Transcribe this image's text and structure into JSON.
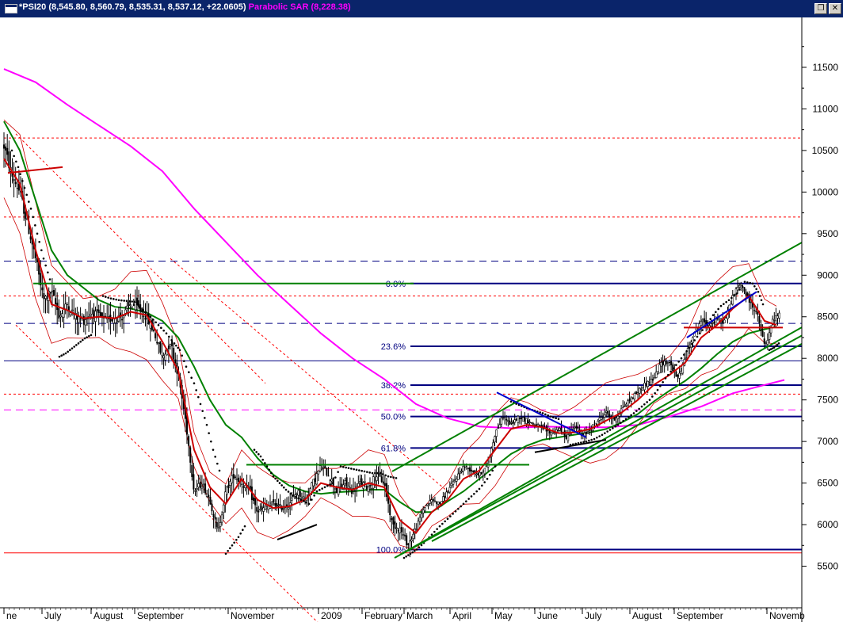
{
  "window": {
    "title_symbol": "*PSI20",
    "title_values": "(8,545.80, 8,560.79, 8,535.31, 8,537.12, +22.0605)",
    "title_indicator": "Parabolic SAR",
    "title_indicator_value": "(8,228.38)",
    "restore_glyph": "❐",
    "close_glyph": "✕",
    "icons": [
      "window-menu-icon",
      "restore-icon",
      "close-icon"
    ]
  },
  "chart_data": {
    "type": "line",
    "title": "*PSI20 (8,545.80, 8,560.79, 8,535.31, 8,537.12, +22.0605) Parabolic SAR (8,228.38)",
    "yticks": [
      5500,
      6000,
      6500,
      7000,
      7500,
      8000,
      8500,
      9000,
      9500,
      10000,
      10500,
      11000,
      11500
    ],
    "ylim": [
      5000,
      12100
    ],
    "xlabels": [
      "ne",
      "July",
      "August",
      "September",
      "November",
      "2009",
      "February",
      "March",
      "April",
      "May",
      "June",
      "July",
      "August",
      "September",
      "Novemb"
    ],
    "x_axis_note": "daily bars, June 2008 to November 2009",
    "colors": {
      "price": "#000000",
      "ma_fast": "#cc0000",
      "ma_mid": "#008000",
      "ma_slow": "#ff00ff",
      "envelope": "#cc0000",
      "sar": "#000000",
      "fib": "#000080",
      "trend_green": "#008000",
      "grid_red": "#ff0000",
      "grid_blue": "#000080"
    },
    "fibonacci": {
      "high": 8900,
      "low": 5700,
      "levels": [
        {
          "label": "0.0%",
          "value": 8900
        },
        {
          "label": "23.6%",
          "value": 8145
        },
        {
          "label": "38.2%",
          "value": 7678
        },
        {
          "label": "50.0%",
          "value": 7300
        },
        {
          "label": "61.8%",
          "value": 6922
        },
        {
          "label": "100.0%",
          "value": 5700
        }
      ]
    },
    "horizontal_lines": [
      {
        "value": 10650,
        "style": "red-dotted"
      },
      {
        "value": 9700,
        "style": "red-dotted"
      },
      {
        "value": 9170,
        "style": "blue-dashed"
      },
      {
        "value": 8750,
        "style": "red-dotted"
      },
      {
        "value": 8420,
        "style": "blue-dashed"
      },
      {
        "value": 7970,
        "style": "blue-solid"
      },
      {
        "value": 7570,
        "style": "red-dotted"
      },
      {
        "value": 7380,
        "style": "magenta-dashed"
      },
      {
        "value": 5660,
        "style": "red-solid"
      }
    ],
    "price_path": [
      [
        0,
        10550
      ],
      [
        10,
        10200
      ],
      [
        20,
        10000
      ],
      [
        30,
        9600
      ],
      [
        40,
        9200
      ],
      [
        50,
        8700
      ],
      [
        60,
        8800
      ],
      [
        70,
        8500
      ],
      [
        80,
        8650
      ],
      [
        90,
        8500
      ],
      [
        100,
        8450
      ],
      [
        110,
        8550
      ],
      [
        120,
        8500
      ],
      [
        130,
        8450
      ],
      [
        140,
        8500
      ],
      [
        150,
        8500
      ],
      [
        160,
        8650
      ],
      [
        170,
        8600
      ],
      [
        180,
        8500
      ],
      [
        190,
        8300
      ],
      [
        200,
        8000
      ],
      [
        210,
        8200
      ],
      [
        220,
        7800
      ],
      [
        230,
        7200
      ],
      [
        240,
        6400
      ],
      [
        250,
        6500
      ],
      [
        260,
        6300
      ],
      [
        270,
        5900
      ],
      [
        280,
        6400
      ],
      [
        290,
        6600
      ],
      [
        300,
        6500
      ],
      [
        310,
        6400
      ],
      [
        320,
        6150
      ],
      [
        330,
        6200
      ],
      [
        340,
        6250
      ],
      [
        350,
        6200
      ],
      [
        360,
        6250
      ],
      [
        370,
        6400
      ],
      [
        380,
        6300
      ],
      [
        390,
        6500
      ],
      [
        400,
        6700
      ],
      [
        410,
        6600
      ],
      [
        420,
        6400
      ],
      [
        430,
        6500
      ],
      [
        440,
        6400
      ],
      [
        450,
        6500
      ],
      [
        460,
        6450
      ],
      [
        470,
        6600
      ],
      [
        480,
        6500
      ],
      [
        490,
        6000
      ],
      [
        500,
        5950
      ],
      [
        510,
        5750
      ],
      [
        520,
        5950
      ],
      [
        530,
        6200
      ],
      [
        540,
        6300
      ],
      [
        550,
        6250
      ],
      [
        560,
        6400
      ],
      [
        570,
        6550
      ],
      [
        580,
        6700
      ],
      [
        590,
        6650
      ],
      [
        600,
        6600
      ],
      [
        610,
        6700
      ],
      [
        620,
        7100
      ],
      [
        630,
        7300
      ],
      [
        640,
        7200
      ],
      [
        650,
        7300
      ],
      [
        660,
        7250
      ],
      [
        670,
        7200
      ],
      [
        680,
        7150
      ],
      [
        690,
        7100
      ],
      [
        700,
        7150
      ],
      [
        710,
        7050
      ],
      [
        720,
        7200
      ],
      [
        730,
        7050
      ],
      [
        740,
        7150
      ],
      [
        750,
        7250
      ],
      [
        760,
        7350
      ],
      [
        770,
        7250
      ],
      [
        780,
        7400
      ],
      [
        790,
        7500
      ],
      [
        800,
        7600
      ],
      [
        810,
        7700
      ],
      [
        820,
        7750
      ],
      [
        830,
        7950
      ],
      [
        840,
        7950
      ],
      [
        850,
        7750
      ],
      [
        860,
        8000
      ],
      [
        870,
        8300
      ],
      [
        880,
        8450
      ],
      [
        890,
        8400
      ],
      [
        900,
        8450
      ],
      [
        910,
        8450
      ],
      [
        920,
        8750
      ],
      [
        930,
        8900
      ],
      [
        940,
        8700
      ],
      [
        950,
        8550
      ],
      [
        960,
        8150
      ],
      [
        965,
        8250
      ],
      [
        970,
        8450
      ],
      [
        980,
        8540
      ]
    ],
    "ma_fast": [
      [
        0,
        10400
      ],
      [
        20,
        10100
      ],
      [
        40,
        9300
      ],
      [
        60,
        8650
      ],
      [
        80,
        8580
      ],
      [
        100,
        8480
      ],
      [
        120,
        8500
      ],
      [
        140,
        8480
      ],
      [
        160,
        8560
      ],
      [
        180,
        8520
      ],
      [
        200,
        8200
      ],
      [
        220,
        7850
      ],
      [
        240,
        6900
      ],
      [
        260,
        6450
      ],
      [
        280,
        6250
      ],
      [
        300,
        6550
      ],
      [
        320,
        6300
      ],
      [
        340,
        6200
      ],
      [
        360,
        6220
      ],
      [
        380,
        6300
      ],
      [
        400,
        6500
      ],
      [
        420,
        6450
      ],
      [
        440,
        6420
      ],
      [
        460,
        6500
      ],
      [
        480,
        6450
      ],
      [
        500,
        6050
      ],
      [
        520,
        5900
      ],
      [
        540,
        6150
      ],
      [
        560,
        6300
      ],
      [
        580,
        6550
      ],
      [
        600,
        6650
      ],
      [
        620,
        6900
      ],
      [
        640,
        7150
      ],
      [
        660,
        7200
      ],
      [
        680,
        7170
      ],
      [
        700,
        7100
      ],
      [
        720,
        7110
      ],
      [
        740,
        7150
      ],
      [
        760,
        7250
      ],
      [
        780,
        7350
      ],
      [
        800,
        7500
      ],
      [
        820,
        7680
      ],
      [
        840,
        7800
      ],
      [
        860,
        7950
      ],
      [
        880,
        8250
      ],
      [
        900,
        8400
      ],
      [
        920,
        8600
      ],
      [
        940,
        8750
      ],
      [
        960,
        8450
      ],
      [
        975,
        8400
      ]
    ],
    "ma_mid": [
      [
        0,
        10850
      ],
      [
        20,
        10500
      ],
      [
        40,
        9900
      ],
      [
        60,
        9300
      ],
      [
        80,
        9000
      ],
      [
        100,
        8850
      ],
      [
        120,
        8700
      ],
      [
        140,
        8620
      ],
      [
        160,
        8600
      ],
      [
        180,
        8550
      ],
      [
        200,
        8450
      ],
      [
        220,
        8250
      ],
      [
        240,
        7900
      ],
      [
        260,
        7500
      ],
      [
        280,
        7200
      ],
      [
        300,
        7050
      ],
      [
        320,
        6800
      ],
      [
        340,
        6600
      ],
      [
        360,
        6470
      ],
      [
        380,
        6400
      ],
      [
        400,
        6370
      ],
      [
        420,
        6390
      ],
      [
        440,
        6400
      ],
      [
        460,
        6420
      ],
      [
        480,
        6420
      ],
      [
        500,
        6270
      ],
      [
        520,
        6150
      ],
      [
        540,
        6150
      ],
      [
        560,
        6280
      ],
      [
        580,
        6400
      ],
      [
        600,
        6550
      ],
      [
        620,
        6700
      ],
      [
        640,
        6850
      ],
      [
        660,
        6950
      ],
      [
        680,
        7020
      ],
      [
        700,
        7050
      ],
      [
        720,
        7080
      ],
      [
        740,
        7110
      ],
      [
        760,
        7150
      ],
      [
        780,
        7230
      ],
      [
        800,
        7330
      ],
      [
        820,
        7480
      ],
      [
        840,
        7610
      ],
      [
        860,
        7730
      ],
      [
        880,
        7880
      ],
      [
        900,
        8050
      ],
      [
        920,
        8200
      ],
      [
        940,
        8300
      ],
      [
        960,
        8350
      ],
      [
        975,
        8380
      ]
    ],
    "ma_slow": [
      [
        0,
        11480
      ],
      [
        40,
        11320
      ],
      [
        80,
        11050
      ],
      [
        120,
        10800
      ],
      [
        160,
        10550
      ],
      [
        200,
        10250
      ],
      [
        240,
        9800
      ],
      [
        280,
        9400
      ],
      [
        320,
        9000
      ],
      [
        360,
        8650
      ],
      [
        400,
        8300
      ],
      [
        440,
        8000
      ],
      [
        480,
        7750
      ],
      [
        520,
        7450
      ],
      [
        560,
        7280
      ],
      [
        600,
        7180
      ],
      [
        640,
        7160
      ],
      [
        680,
        7180
      ],
      [
        720,
        7170
      ],
      [
        760,
        7170
      ],
      [
        800,
        7200
      ],
      [
        840,
        7300
      ],
      [
        880,
        7420
      ],
      [
        920,
        7580
      ],
      [
        960,
        7680
      ],
      [
        985,
        7740
      ]
    ],
    "sar_dots": [
      [
        10,
        10500
      ],
      [
        18,
        10300
      ],
      [
        26,
        10050
      ],
      [
        34,
        9800
      ],
      [
        42,
        9500
      ],
      [
        50,
        9200
      ],
      [
        58,
        8950
      ],
      [
        70,
        8020
      ],
      [
        78,
        8060
      ],
      [
        86,
        8120
      ],
      [
        94,
        8180
      ],
      [
        102,
        8240
      ],
      [
        110,
        8280
      ],
      [
        125,
        8750
      ],
      [
        135,
        8720
      ],
      [
        145,
        8700
      ],
      [
        155,
        8690
      ],
      [
        165,
        8680
      ],
      [
        175,
        8580
      ],
      [
        185,
        8500
      ],
      [
        195,
        8400
      ],
      [
        205,
        8300
      ],
      [
        215,
        8180
      ],
      [
        222,
        8100
      ],
      [
        230,
        7900
      ],
      [
        240,
        7700
      ],
      [
        248,
        7450
      ],
      [
        256,
        7200
      ],
      [
        264,
        6900
      ],
      [
        272,
        6650
      ],
      [
        280,
        5650
      ],
      [
        288,
        5750
      ],
      [
        296,
        5850
      ],
      [
        304,
        5980
      ],
      [
        316,
        6900
      ],
      [
        324,
        6820
      ],
      [
        332,
        6700
      ],
      [
        340,
        6580
      ],
      [
        348,
        6500
      ],
      [
        356,
        6420
      ],
      [
        365,
        6350
      ],
      [
        375,
        6300
      ],
      [
        385,
        6250
      ],
      [
        395,
        6400
      ],
      [
        405,
        6450
      ],
      [
        415,
        6500
      ],
      [
        425,
        6700
      ],
      [
        435,
        6680
      ],
      [
        445,
        6660
      ],
      [
        455,
        6640
      ],
      [
        465,
        6620
      ],
      [
        475,
        6620
      ],
      [
        485,
        6580
      ],
      [
        495,
        6560
      ],
      [
        505,
        5600
      ],
      [
        513,
        5650
      ],
      [
        521,
        5700
      ],
      [
        530,
        5780
      ],
      [
        540,
        5880
      ],
      [
        550,
        5980
      ],
      [
        560,
        6070
      ],
      [
        570,
        6160
      ],
      [
        580,
        6250
      ],
      [
        590,
        6340
      ],
      [
        600,
        6430
      ],
      [
        610,
        6550
      ],
      [
        620,
        6700
      ],
      [
        640,
        7480
      ],
      [
        650,
        7440
      ],
      [
        660,
        7400
      ],
      [
        670,
        7370
      ],
      [
        680,
        7340
      ],
      [
        690,
        7300
      ],
      [
        700,
        7270
      ],
      [
        715,
        6960
      ],
      [
        725,
        6980
      ],
      [
        735,
        7000
      ],
      [
        745,
        7030
      ],
      [
        755,
        7080
      ],
      [
        765,
        7140
      ],
      [
        775,
        7200
      ],
      [
        785,
        7270
      ],
      [
        795,
        7340
      ],
      [
        805,
        7420
      ],
      [
        815,
        7500
      ],
      [
        825,
        7620
      ],
      [
        835,
        7760
      ],
      [
        845,
        7880
      ],
      [
        855,
        8000
      ],
      [
        865,
        8130
      ],
      [
        875,
        8260
      ],
      [
        885,
        8380
      ],
      [
        895,
        8520
      ],
      [
        905,
        8630
      ],
      [
        915,
        8700
      ],
      [
        925,
        8780
      ],
      [
        935,
        8920
      ],
      [
        945,
        8900
      ],
      [
        952,
        8800
      ],
      [
        958,
        8650
      ],
      [
        966,
        8100
      ],
      [
        972,
        8130
      ],
      [
        978,
        8180
      ]
    ],
    "trendlines": [
      {
        "from": [
          490,
          6640
        ],
        "to": [
          1012,
          9420
        ],
        "color": "green"
      },
      {
        "from": [
          500,
          5640
        ],
        "to": [
          1012,
          8400
        ],
        "color": "green"
      },
      {
        "from": [
          493,
          5600
        ],
        "to": [
          1012,
          8300
        ],
        "color": "green"
      },
      {
        "from": [
          540,
          5800
        ],
        "to": [
          1012,
          8200
        ],
        "color": "green"
      },
      {
        "from": [
          37,
          8900
        ],
        "to": [
          517,
          8900
        ],
        "color": "green"
      },
      {
        "from": [
          306,
          6720
        ],
        "to": [
          663,
          6720
        ],
        "color": "green"
      },
      {
        "from": [
          5,
          10230
        ],
        "to": [
          74,
          10300
        ],
        "color": "red"
      },
      {
        "from": [
          858,
          8370
        ],
        "to": [
          983,
          8370
        ],
        "color": "red"
      },
      {
        "from": [
          622,
          7590
        ],
        "to": [
          735,
          7050
        ],
        "color": "blue"
      },
      {
        "from": [
          862,
          8250
        ],
        "to": [
          950,
          8800
        ],
        "color": "blue"
      },
      {
        "from": [
          345,
          5820
        ],
        "to": [
          395,
          6000
        ],
        "color": "black"
      },
      {
        "from": [
          670,
          6870
        ],
        "to": [
          760,
          7020
        ],
        "color": "black"
      }
    ],
    "diagonal_channel": [
      {
        "from": [
          15,
          10700
        ],
        "to": [
          330,
          7700
        ],
        "style": "red-dotted"
      },
      {
        "from": [
          15,
          8400
        ],
        "to": [
          420,
          4600
        ],
        "style": "red-dotted"
      },
      {
        "from": [
          210,
          9200
        ],
        "to": [
          560,
          6400
        ],
        "style": "red-dotted"
      }
    ]
  }
}
